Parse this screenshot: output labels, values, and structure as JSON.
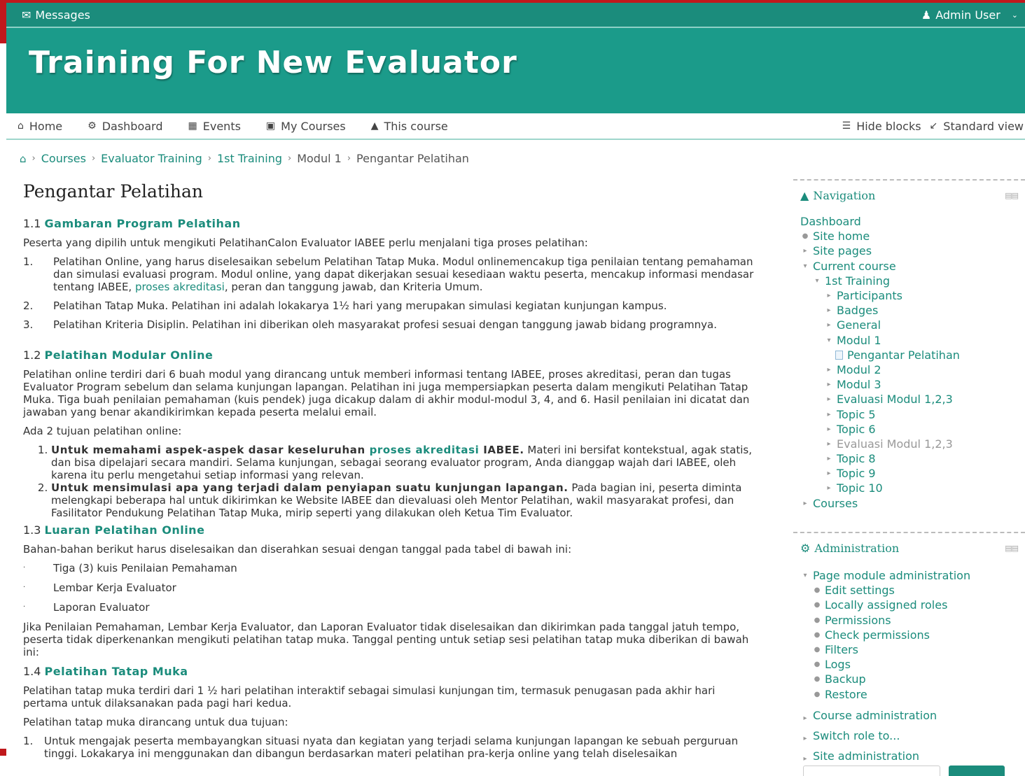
{
  "topbar": {
    "messages": "Messages",
    "user": "Admin User"
  },
  "banner": {
    "title": "Training For New Evaluator"
  },
  "nav": {
    "items": [
      {
        "label": "Home",
        "icon": "home-icon"
      },
      {
        "label": "Dashboard",
        "icon": "dashboard-icon"
      },
      {
        "label": "Events",
        "icon": "calendar-icon"
      },
      {
        "label": "My Courses",
        "icon": "briefcase-icon"
      },
      {
        "label": "This course",
        "icon": "sitemap-icon"
      }
    ],
    "hide_blocks": "Hide blocks",
    "standard_view": "Standard view"
  },
  "breadcrumb": [
    "Courses",
    "Evaluator Training",
    "1st Training",
    "Modul 1",
    "Pengantar Pelatihan"
  ],
  "content": {
    "title": "Pengantar Pelatihan",
    "s1": {
      "num": "1.1",
      "title": "Gambaran Program Pelatihan"
    },
    "p1": "Peserta yang dipilih untuk mengikuti PelatihanCalon Evaluator IABEE perlu menjalani tiga proses pelatihan:",
    "l1": {
      "n": "1.",
      "pre": "Pelatihan Online, yang harus diselesaikan sebelum Pelatihan Tatap Muka. Modul onlinemencakup tiga penilaian tentang pemahaman dan simulasi evaluasi program. Modul online, yang dapat dikerjakan sesuai kesediaan waktu peserta, mencakup informasi mendasar tentang IABEE, ",
      "link": "proses akreditasi",
      "post": ", peran dan tanggung jawab, dan Kriteria Umum."
    },
    "l2": {
      "n": "2.",
      "text": "Pelatihan Tatap Muka. Pelatihan ini adalah lokakarya 1½ hari yang merupakan simulasi kegiatan kunjungan kampus."
    },
    "l3": {
      "n": "3.",
      "text": "Pelatihan Kriteria Disiplin. Pelatihan ini diberikan oleh masyarakat profesi sesuai dengan tanggung jawab bidang programnya."
    },
    "s2": {
      "num": "1.2",
      "title": "Pelatihan Modular Online"
    },
    "p2": "Pelatihan online terdiri dari 6 buah modul yang dirancang untuk memberi informasi tentang IABEE, proses akreditasi, peran dan tugas Evaluator Program sebelum dan selama kunjungan lapangan. Pelatihan ini juga mempersiapkan peserta dalam mengikuti Pelatihan Tatap Muka. Tiga buah penilaian pemahaman (kuis pendek) juga dicakup dalam di akhir modul-modul 3, 4, and 6. Hasil penilaian ini dicatat dan jawaban yang benar akandikirimkan kepada peserta melalui email.",
    "p3": "Ada 2 tujuan pelatihan online:",
    "o1": {
      "b1": "Untuk memahami aspek-aspek dasar keseluruhan ",
      "link": "proses akreditasi",
      "b2": " IABEE.",
      "text": " Materi ini bersifat kontekstual, agak statis, dan bisa dipelajari secara mandiri. Selama kunjungan, sebagai seorang evaluator program, Anda dianggap wajah dari IABEE, oleh karena itu perlu mengetahui setiap informasi yang relevan."
    },
    "o2": {
      "b": "Untuk mensimulasi apa yang terjadi dalam penyiapan suatu kunjungan lapangan.",
      "text": " Pada bagian ini, peserta diminta melengkapi beberapa hal untuk dikirimkan ke Website IABEE dan dievaluasi oleh Mentor Pelatihan, wakil masyarakat profesi, dan Fasilitator Pendukung Pelatihan Tatap Muka, mirip seperti yang dilakukan oleh Ketua Tim Evaluator."
    },
    "s3": {
      "num": "1.3",
      "title": "Luaran Pelatihan Online"
    },
    "p4": "Bahan-bahan berikut harus diselesaikan dan diserahkan sesuai dengan tanggal pada tabel di bawah ini:",
    "bullets": [
      "Tiga (3) kuis Penilaian Pemahaman",
      "Lembar Kerja Evaluator",
      "Laporan Evaluator"
    ],
    "p5": "Jika Penilaian Pemahaman, Lembar Kerja Evaluator, dan Laporan Evaluator tidak diselesaikan dan dikirimkan pada tanggal jatuh tempo, peserta tidak diperkenankan mengikuti pelatihan tatap muka. Tanggal penting untuk setiap sesi pelatihan tatap muka diberikan di bawah ini:",
    "s4": {
      "num": "1.4",
      "title": "Pelatihan Tatap Muka"
    },
    "p6": "Pelatihan tatap muka terdiri dari 1 ½ hari pelatihan interaktif sebagai simulasi kunjungan tim, termasuk penugasan pada akhir hari pertama untuk dilaksanakan pada pagi hari kedua.",
    "p7": "Pelatihan tatap muka dirancang untuk dua tujuan:",
    "l4": {
      "n": "1.",
      "text": "Untuk mengajak peserta membayangkan situasi nyata dan kegiatan yang terjadi selama kunjungan lapangan ke sebuah perguruan tinggi. Lokakarya ini menggunakan dan dibangun berdasarkan materi pelatihan pra-kerja online yang telah diselesaikan"
    }
  },
  "navigation_block": {
    "title": "Navigation",
    "items": [
      {
        "label": "Dashboard"
      },
      {
        "label": "Site home"
      },
      {
        "label": "Site pages"
      },
      {
        "label": "Current course"
      },
      {
        "label": "1st Training"
      },
      {
        "label": "Participants"
      },
      {
        "label": "Badges"
      },
      {
        "label": "General"
      },
      {
        "label": "Modul 1"
      },
      {
        "label": "Pengantar Pelatihan"
      },
      {
        "label": "Modul 2"
      },
      {
        "label": "Modul 3"
      },
      {
        "label": "Evaluasi Modul 1,2,3"
      },
      {
        "label": "Topic 5"
      },
      {
        "label": "Topic 6"
      },
      {
        "label": "Evaluasi Modul 1,2,3"
      },
      {
        "label": "Topic 8"
      },
      {
        "label": "Topic 9"
      },
      {
        "label": "Topic 10"
      },
      {
        "label": "Courses"
      }
    ]
  },
  "admin_block": {
    "title": "Administration",
    "items": [
      {
        "label": "Page module administration"
      },
      {
        "label": "Edit settings"
      },
      {
        "label": "Locally assigned roles"
      },
      {
        "label": "Permissions"
      },
      {
        "label": "Check permissions"
      },
      {
        "label": "Filters"
      },
      {
        "label": "Logs"
      },
      {
        "label": "Backup"
      },
      {
        "label": "Restore"
      }
    ],
    "sections": [
      {
        "label": "Course administration"
      },
      {
        "label": "Switch role to..."
      },
      {
        "label": "Site administration"
      }
    ]
  },
  "colors": {
    "accent": "#1b8c7c",
    "banner": "#1b9b8a",
    "topbar": "#1b8c7c"
  }
}
